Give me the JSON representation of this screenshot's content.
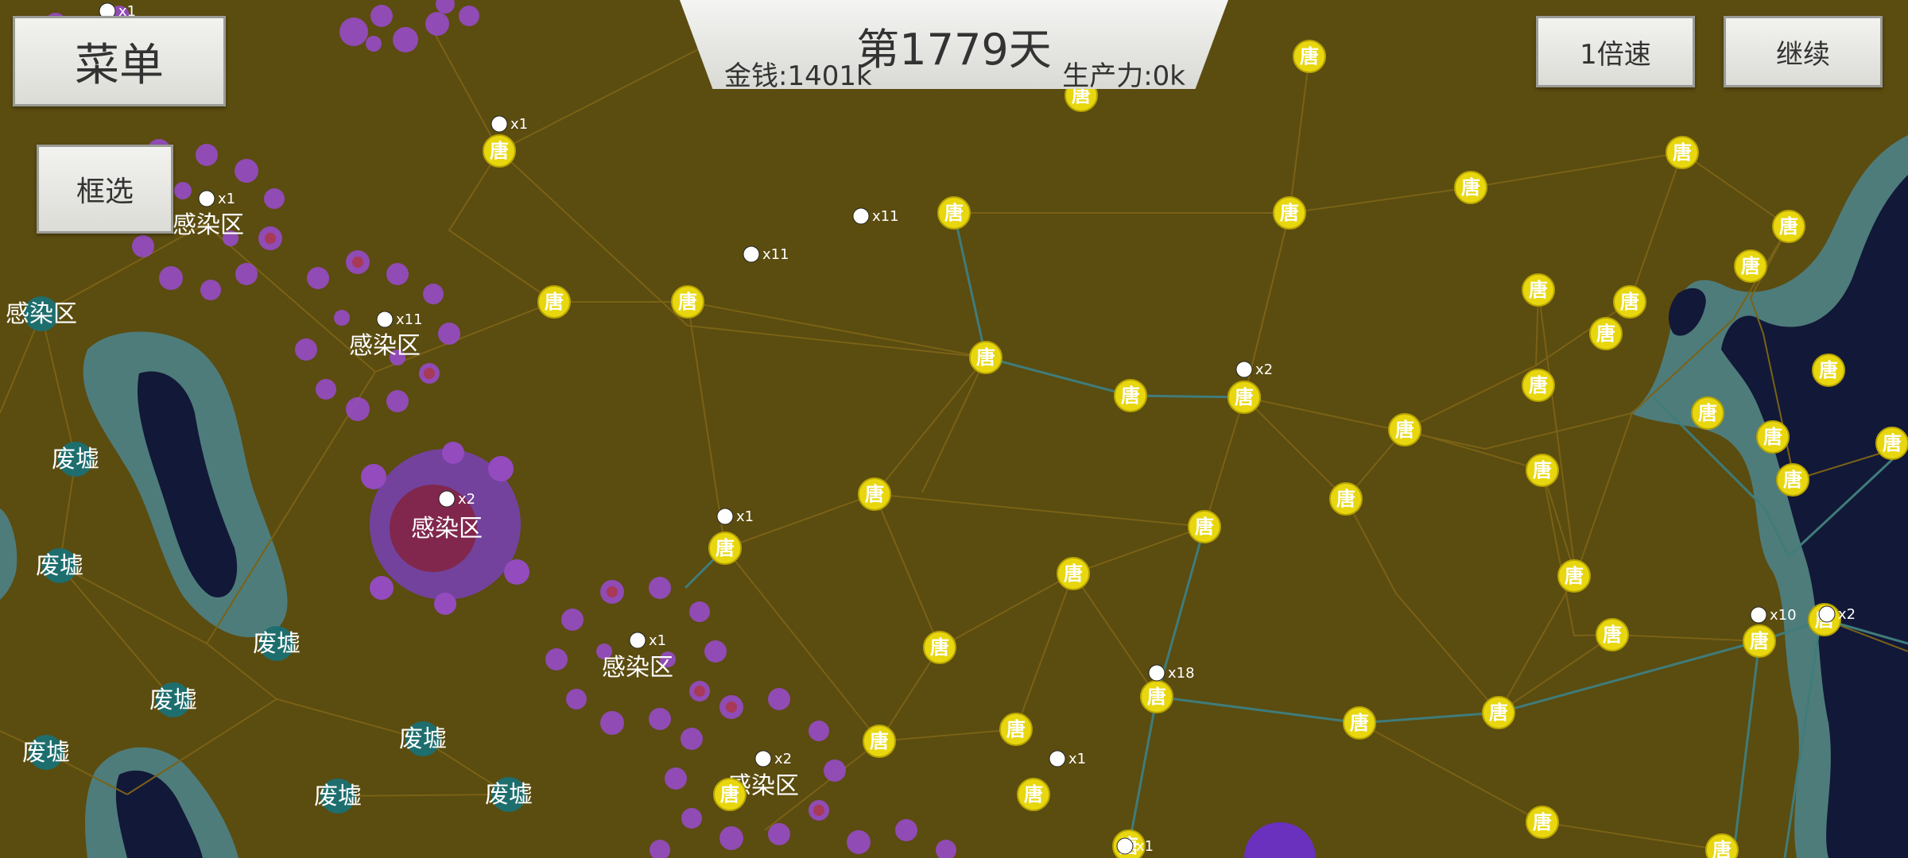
{
  "hud": {
    "menu_label": "菜单",
    "select_label": "框选",
    "day_label": "第1779天",
    "money_label": "金钱:1401k",
    "productivity_label": "生产力:0k",
    "speed_label": "1倍速",
    "continue_label": "继续"
  },
  "map": {
    "city_char": "唐",
    "city_count": 46,
    "infected_label": "感染区",
    "ruins_label": "废墟",
    "infected_zone_count": 7,
    "ruins_count": 9,
    "army_counts": [
      "x1",
      "x1",
      "x1",
      "x11",
      "x11",
      "x11",
      "x1",
      "x2",
      "x2",
      "x1",
      "x2",
      "x18",
      "x1",
      "x10",
      "x2",
      "x1"
    ],
    "colors": {
      "background": "#5b4c10",
      "city_fill": "#e8d70f",
      "ruins_fill": "#1e6e6e",
      "water": "#121838",
      "coast": "#4e7c7a",
      "infection": "#9a4bd1",
      "road": "#7a6216",
      "active_road": "#3f7c7a"
    }
  }
}
